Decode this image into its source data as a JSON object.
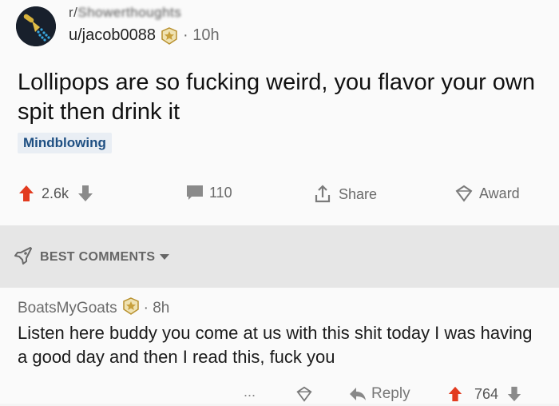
{
  "post": {
    "subreddit_prefix": "r/",
    "subreddit_name": "Showerthoughts",
    "author": "u/jacob0088",
    "age": "10h",
    "title": "Lollipops are so fucking weird, you flavor your own spit then drink it",
    "flair": "Mindblowing",
    "votes": "2.6k",
    "comments": "110",
    "share_label": "Share",
    "award_label": "Award"
  },
  "sort": {
    "label": "BEST COMMENTS"
  },
  "comment": {
    "author": "BoatsMyGoats",
    "age": "8h",
    "body": "Listen here buddy you come at us with this shit today I was having a good day and then I read this, fuck you",
    "more": "...",
    "reply_label": "Reply",
    "votes": "764"
  },
  "colors": {
    "upvote": "#e23b1f",
    "flair_bg": "#e9eef4",
    "flair_text": "#1e4f82",
    "badge": "#c8a03c"
  }
}
